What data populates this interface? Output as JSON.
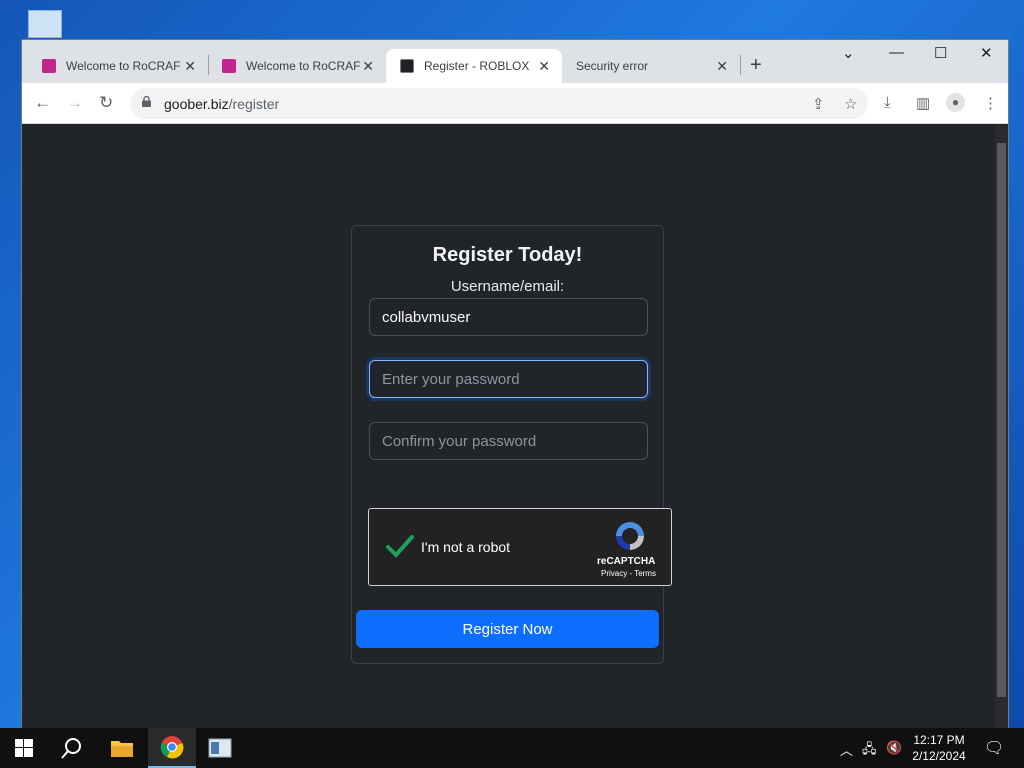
{
  "browser": {
    "tabs": [
      {
        "label": "Welcome to RoCRAFT",
        "favicon_color": "#c0268c",
        "active": false
      },
      {
        "label": "Welcome to RoCRAFT",
        "favicon_color": "#c0268c",
        "active": false
      },
      {
        "label": "Register - ROBLOX",
        "favicon_color": "#202124",
        "active": true
      },
      {
        "label": "Security error",
        "favicon_color": null,
        "active": false
      }
    ],
    "url_host": "goober.biz",
    "url_path": "/register"
  },
  "register": {
    "title": "Register Today!",
    "username_label": "Username/email:",
    "username_value": "collabvmuser",
    "password_placeholder": "Enter your password",
    "confirm_placeholder": "Confirm your password",
    "captcha_label": "I'm not a robot",
    "captcha_brand": "reCAPTCHA",
    "captcha_links": "Privacy - Terms",
    "submit_label": "Register Now"
  },
  "taskbar": {
    "time": "12:17 PM",
    "date": "2/12/2024"
  },
  "colors": {
    "accent": "#0d6efd",
    "page_bg": "#212529",
    "check_green": "#1e9f5b"
  }
}
